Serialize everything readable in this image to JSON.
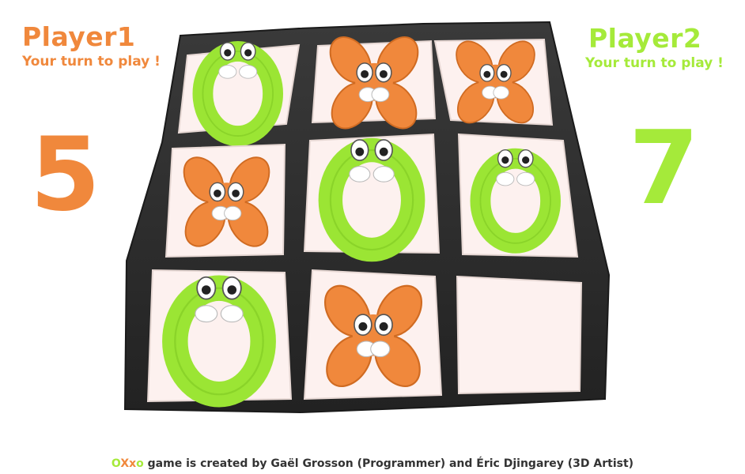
{
  "player1": {
    "name": "Player1",
    "status": "Your turn to play !",
    "score": "5",
    "color": "#f0883c"
  },
  "player2": {
    "name": "Player2",
    "status": "Your turn to play !",
    "score": "7",
    "color": "#a5ea3a"
  },
  "board": {
    "cells": [
      "O",
      "X",
      "X",
      "X",
      "O",
      "O",
      "O",
      "X",
      ""
    ]
  },
  "credits": {
    "logo_o1": "O",
    "logo_x1": "X",
    "logo_x2": "x",
    "logo_o2": "o",
    "text": " game is created by Gaël Grosson (Programmer) and Éric Djingarey (3D Artist)"
  },
  "colors": {
    "frame": "#2d2d2d",
    "cell": "#fdf1ef",
    "o_piece": "#9be534",
    "x_piece": "#f0883c"
  }
}
